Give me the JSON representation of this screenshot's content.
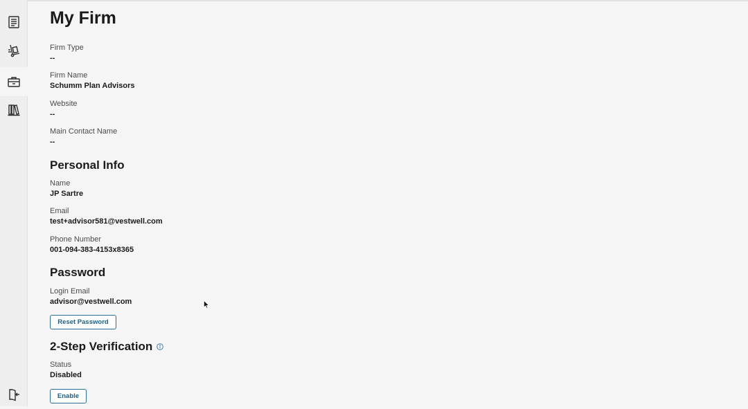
{
  "sidebar": {
    "items": [
      {
        "icon": "document-list-icon"
      },
      {
        "icon": "hand-truck-icon"
      },
      {
        "icon": "briefcase-icon"
      },
      {
        "icon": "books-icon"
      }
    ],
    "bottom": {
      "icon": "logout-icon"
    }
  },
  "page": {
    "title": "My Firm"
  },
  "firm": {
    "firm_type_label": "Firm Type",
    "firm_type_value": "--",
    "firm_name_label": "Firm Name",
    "firm_name_value": "Schumm Plan Advisors",
    "website_label": "Website",
    "website_value": "--",
    "contact_label": "Main Contact Name",
    "contact_value": "--"
  },
  "personal": {
    "heading": "Personal Info",
    "name_label": "Name",
    "name_value": "JP Sartre",
    "email_label": "Email",
    "email_value": "test+advisor581@vestwell.com",
    "phone_label": "Phone Number",
    "phone_value": "001-094-383-4153x8365"
  },
  "password": {
    "heading": "Password",
    "login_email_label": "Login Email",
    "login_email_value": "advisor@vestwell.com",
    "reset_button": "Reset Password"
  },
  "two_step": {
    "heading": "2-Step Verification",
    "status_label": "Status",
    "status_value": "Disabled",
    "enable_button": "Enable"
  },
  "colors": {
    "accent": "#2a6f97",
    "background": "#f5f5f5",
    "sidebar": "#eeeeee"
  }
}
